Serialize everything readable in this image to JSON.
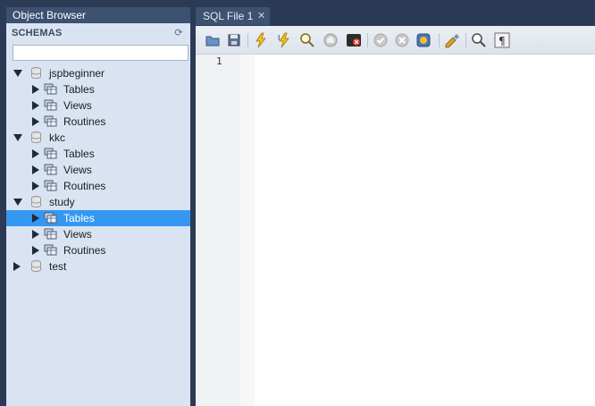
{
  "left_panel": {
    "title": "Object Browser",
    "schemas_label": "SCHEMAS",
    "filter_placeholder": "",
    "refresh_icon": "refresh-icon"
  },
  "tree": {
    "schemas": [
      {
        "name": "jspbeginner",
        "expanded": true,
        "children": [
          "Tables",
          "Views",
          "Routines"
        ]
      },
      {
        "name": "kkc",
        "expanded": true,
        "children": [
          "Tables",
          "Views",
          "Routines"
        ]
      },
      {
        "name": "study",
        "expanded": true,
        "children": [
          "Tables",
          "Views",
          "Routines"
        ],
        "selected_child": 0
      },
      {
        "name": "test",
        "expanded": false,
        "children": []
      }
    ]
  },
  "tab": {
    "label": "SQL File 1",
    "close": "✕"
  },
  "toolbar": {
    "icons": [
      "open-file-icon",
      "save-icon",
      "execute-icon",
      "execute-current-icon",
      "explain-icon",
      "stop-icon",
      "toggle-error-icon",
      "commit-icon",
      "rollback-icon",
      "autocommit-icon",
      "beautify-icon",
      "find-icon",
      "invisible-chars-icon"
    ]
  },
  "editor": {
    "line_number": "1"
  },
  "colors": {
    "panel_bg": "#d9e3f1",
    "header_bg": "#3d5170",
    "selected": "#3498f3",
    "window_bg": "#2b3a55"
  }
}
